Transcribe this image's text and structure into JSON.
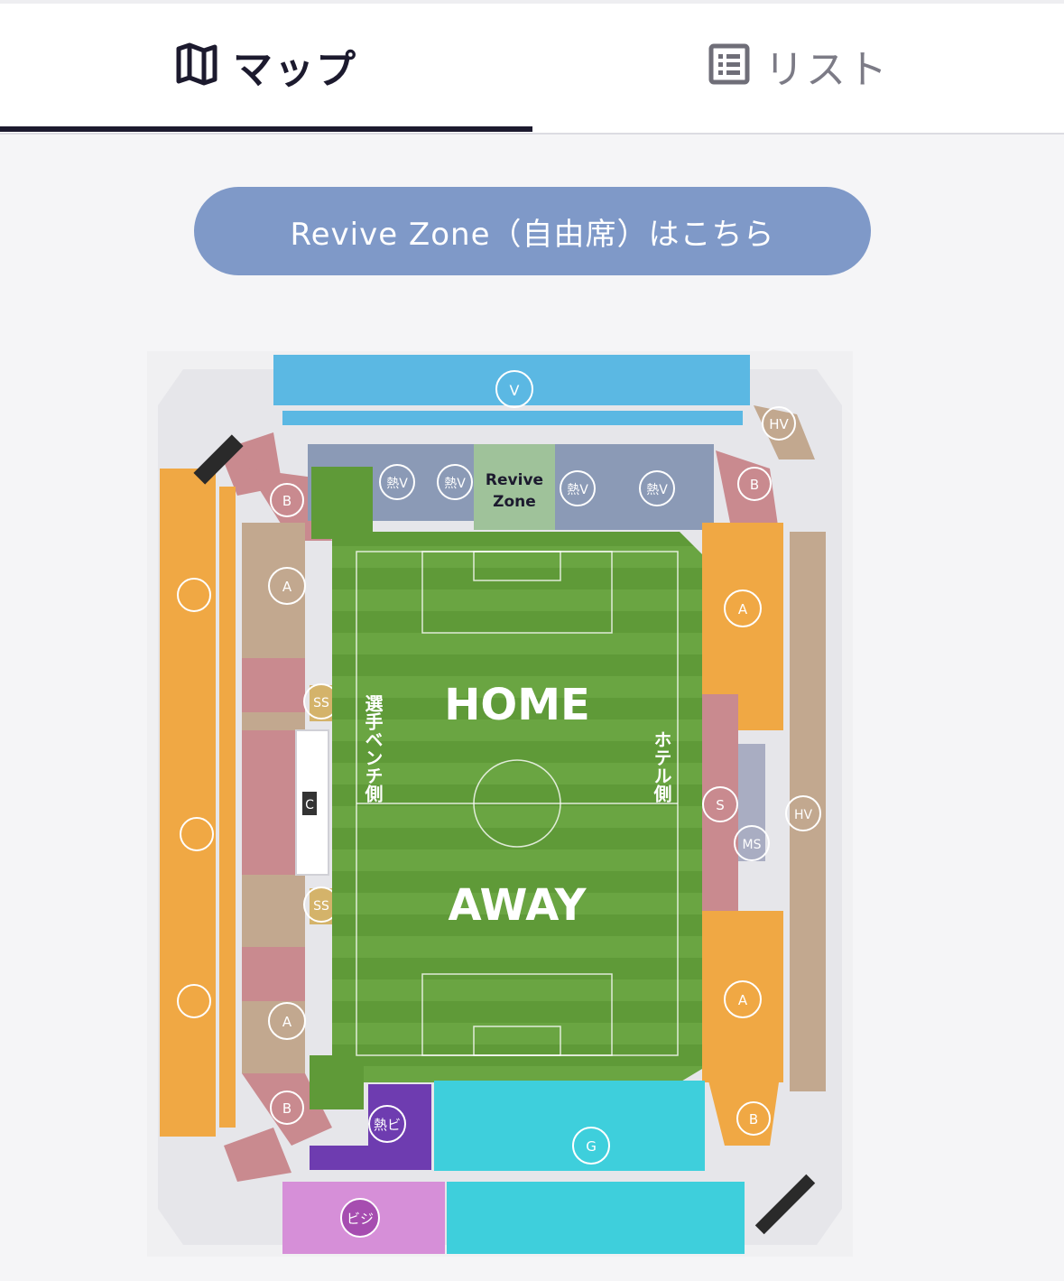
{
  "tabs": {
    "map": {
      "label": "マップ",
      "icon": "map-icon",
      "active": true
    },
    "list": {
      "label": "リスト",
      "icon": "list-icon",
      "active": false
    }
  },
  "revive_button": {
    "label": "Revive Zone（自由席）はこちら"
  },
  "stadium_map": {
    "pitch": {
      "home_label": "HOME",
      "away_label": "AWAY",
      "left_side_label": "選手ベンチ側",
      "right_side_label": "ホテル側"
    },
    "zones": {
      "revive_zone_label_line1": "Revive",
      "revive_zone_label_line2": "Zone",
      "v": "V",
      "hv_top": "HV",
      "b_top_left": "B",
      "b_top_right": "B",
      "b_bottom_left": "B",
      "b_bottom_right": "B",
      "a_left_upper": "A",
      "a_left_lower": "A",
      "a_right_upper": "A",
      "a_right_lower": "A",
      "ss_upper": "SS",
      "ss_lower": "SS",
      "c": "C",
      "s": "S",
      "ms": "MS",
      "hv_right": "HV",
      "netsu_v_1": "熱V",
      "netsu_v_2": "熱V",
      "netsu_v_3": "熱V",
      "netsu_v_4": "熱V",
      "netsu_bi": "熱ビ",
      "g": "G",
      "bizi": "ビジ"
    }
  },
  "colors": {
    "active_tab_text": "#1c1a2e",
    "inactive_tab_text": "#7c7b86",
    "revive_button_bg": "#7f99c8",
    "pitch": "#5f9a38",
    "v_seats": "#5bb8e3",
    "home_seats_orange": "#f0a844",
    "seats_pink": "#c98a8f",
    "seats_brown": "#c2a88f",
    "netsu_seats": "#8b9ab6",
    "revive_seats": "#9fc29a",
    "bizi_seats": "#d68fd8",
    "netsu_bi_seats": "#6e3cb0",
    "away_seats_cyan": "#3ecfdc",
    "ms_seats": "#a9adc2"
  }
}
